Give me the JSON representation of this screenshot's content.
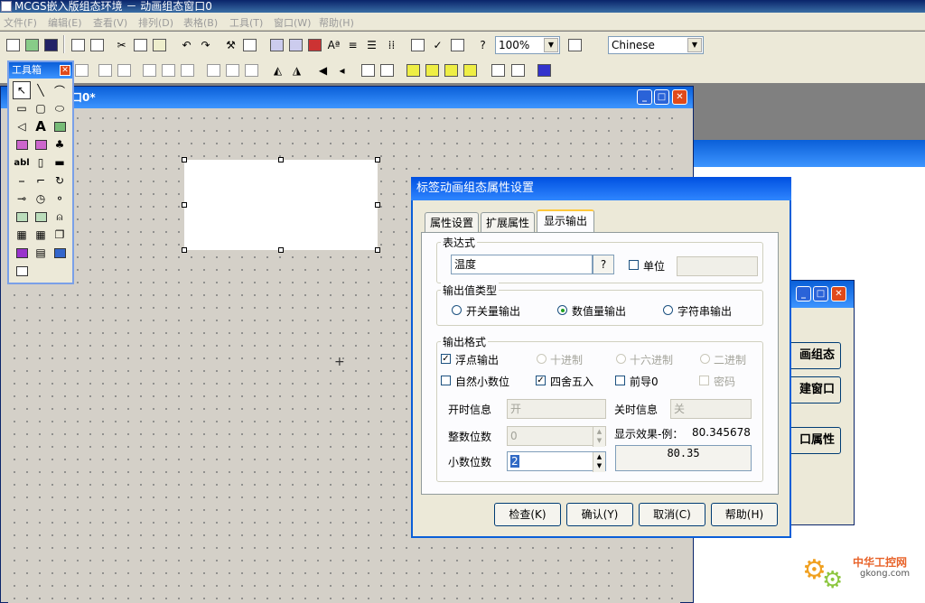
{
  "app": {
    "title": "MCGS嵌入版组态环境 － 动画组态窗口0"
  },
  "menu": [
    "文件(F)",
    "编辑(E)",
    "查看(V)",
    "排列(D)",
    "表格(B)",
    "工具(T)",
    "窗口(W)",
    "帮助(H)"
  ],
  "toolbar": {
    "zoom": "100%",
    "language": "Chinese"
  },
  "toolbox": {
    "title": "工具箱"
  },
  "canvas_window": {
    "title": "动画组态窗口0*",
    "title_visible": "口0*"
  },
  "behind_dialog": {
    "buttons": [
      "画组态",
      "建窗口",
      "口属性"
    ]
  },
  "dialog": {
    "title": "标签动画组态属性设置",
    "tabs": [
      "属性设置",
      "扩展属性",
      "显示输出"
    ],
    "expression": {
      "group_label": "表达式",
      "value": "温度",
      "help_button": "?",
      "unit_label": "单位",
      "unit_checked": false,
      "unit_value": ""
    },
    "output_type": {
      "group_label": "输出值类型",
      "options": [
        "开关量输出",
        "数值量输出",
        "字符串输出"
      ],
      "selected": "数值量输出"
    },
    "output_format": {
      "group_label": "输出格式",
      "float_output": {
        "label": "浮点输出",
        "checked": true
      },
      "decimal": "十进制",
      "hex": "十六进制",
      "binary": "二进制",
      "natural_decimal": {
        "label": "自然小数位",
        "checked": false
      },
      "round": {
        "label": "四舍五入",
        "checked": true
      },
      "leading_zero": {
        "label": "前导0",
        "checked": false
      },
      "password": {
        "label": "密码",
        "checked": false
      },
      "on_info_label": "开时信息",
      "on_info_value": "开",
      "off_info_label": "关时信息",
      "off_info_value": "关",
      "integer_digits_label": "整数位数",
      "integer_digits_value": "0",
      "decimal_digits_label": "小数位数",
      "decimal_digits_value": "2",
      "preview_label": "显示效果-例：",
      "preview_example": "80.345678",
      "preview_result": "80.35"
    },
    "buttons": {
      "check": "检查(K)",
      "ok": "确认(Y)",
      "cancel": "取消(C)",
      "help": "帮助(H)"
    }
  },
  "watermark": {
    "line1": "中华工控网",
    "line2": "gkong.com"
  },
  "colors": {
    "titlebar": "#0a5fd8",
    "dialog_bg": "#ece9d8",
    "canvas": "#d4d0c8"
  }
}
